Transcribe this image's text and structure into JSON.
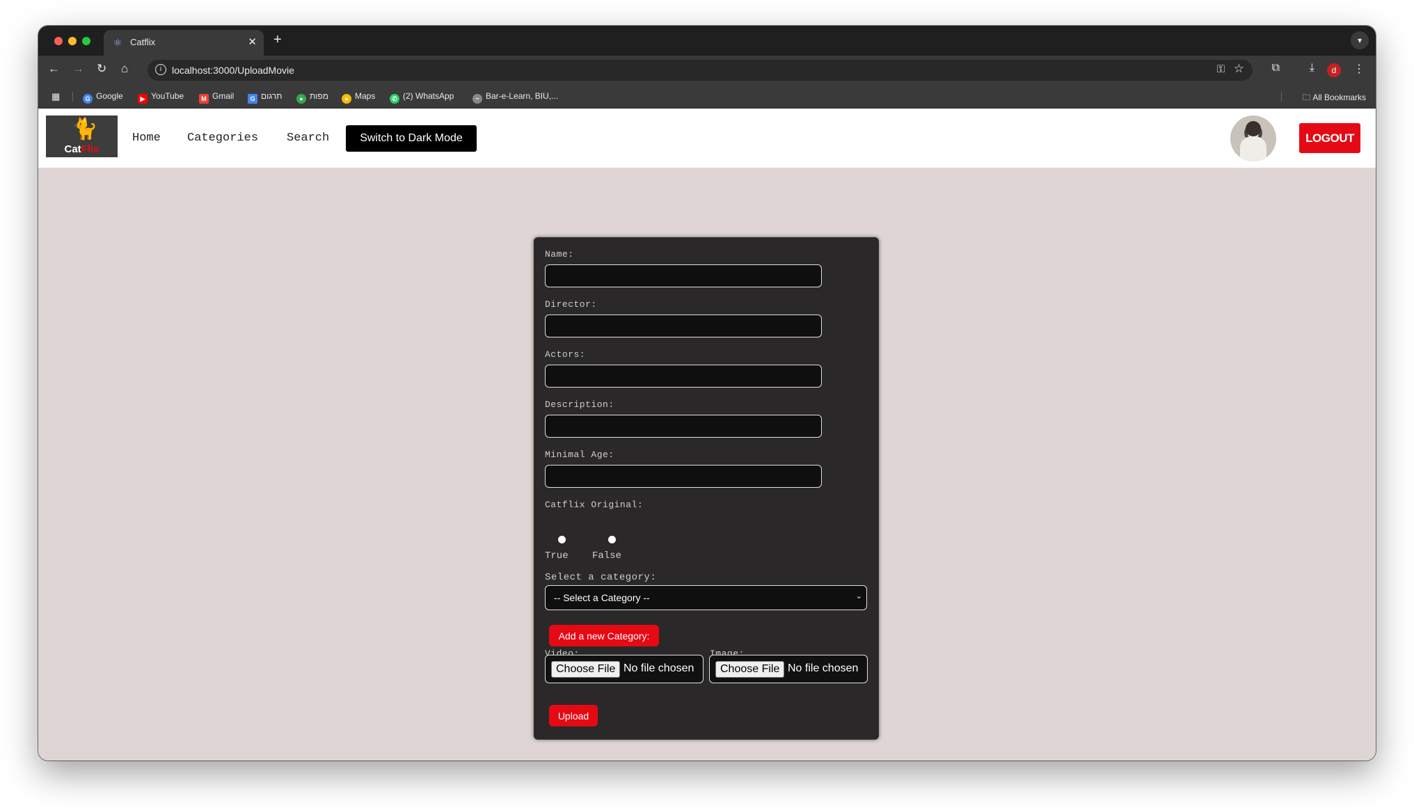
{
  "browser": {
    "tab_title": "Catflix",
    "url": "localhost:3000/UploadMovie",
    "profile_initial": "d",
    "bookmarks": [
      {
        "label": "Google",
        "icon": "google-icon",
        "color": "#4285f4"
      },
      {
        "label": "YouTube",
        "icon": "youtube-icon",
        "color": "#ff0000"
      },
      {
        "label": "Gmail",
        "icon": "gmail-icon",
        "color": "#ea4335"
      },
      {
        "label": "תרגום",
        "icon": "translate-icon",
        "color": "#4285f4"
      },
      {
        "label": "מפות",
        "icon": "maps-pin-icon",
        "color": "#34a853"
      },
      {
        "label": "Maps",
        "icon": "maps-pin-icon",
        "color": "#fbbc04"
      },
      {
        "label": "(2) WhatsApp",
        "icon": "whatsapp-icon",
        "color": "#25d366"
      },
      {
        "label": "Bar-e-Learn, BIU,...",
        "icon": "elearn-icon",
        "color": "#888888"
      }
    ],
    "all_bookmarks_label": "All Bookmarks"
  },
  "navbar": {
    "logo_text_part1": "Cat",
    "logo_text_part2": "Flix",
    "links": [
      "Home",
      "Categories",
      "Search"
    ],
    "dark_mode_label": "Switch to Dark Mode",
    "logout_label": "LOGOUT"
  },
  "form": {
    "name_label": "Name:",
    "director_label": "Director:",
    "actors_label": "Actors:",
    "description_label": "Description:",
    "min_age_label": "Minimal Age:",
    "original_label": "Catflix Original:",
    "true_label": "True",
    "false_label": "False",
    "category_label": "Select a category:",
    "category_selected": "-- Select a Category --",
    "add_category_label": "Add a new Category:",
    "video_label": "Video:",
    "image_label": "Image:",
    "choose_file_label": "Choose File",
    "no_file_label": "No file chosen",
    "upload_label": "Upload"
  },
  "colors": {
    "accent": "#e50914",
    "page_bg": "#dfd5d5",
    "form_bg": "#2a2828"
  }
}
